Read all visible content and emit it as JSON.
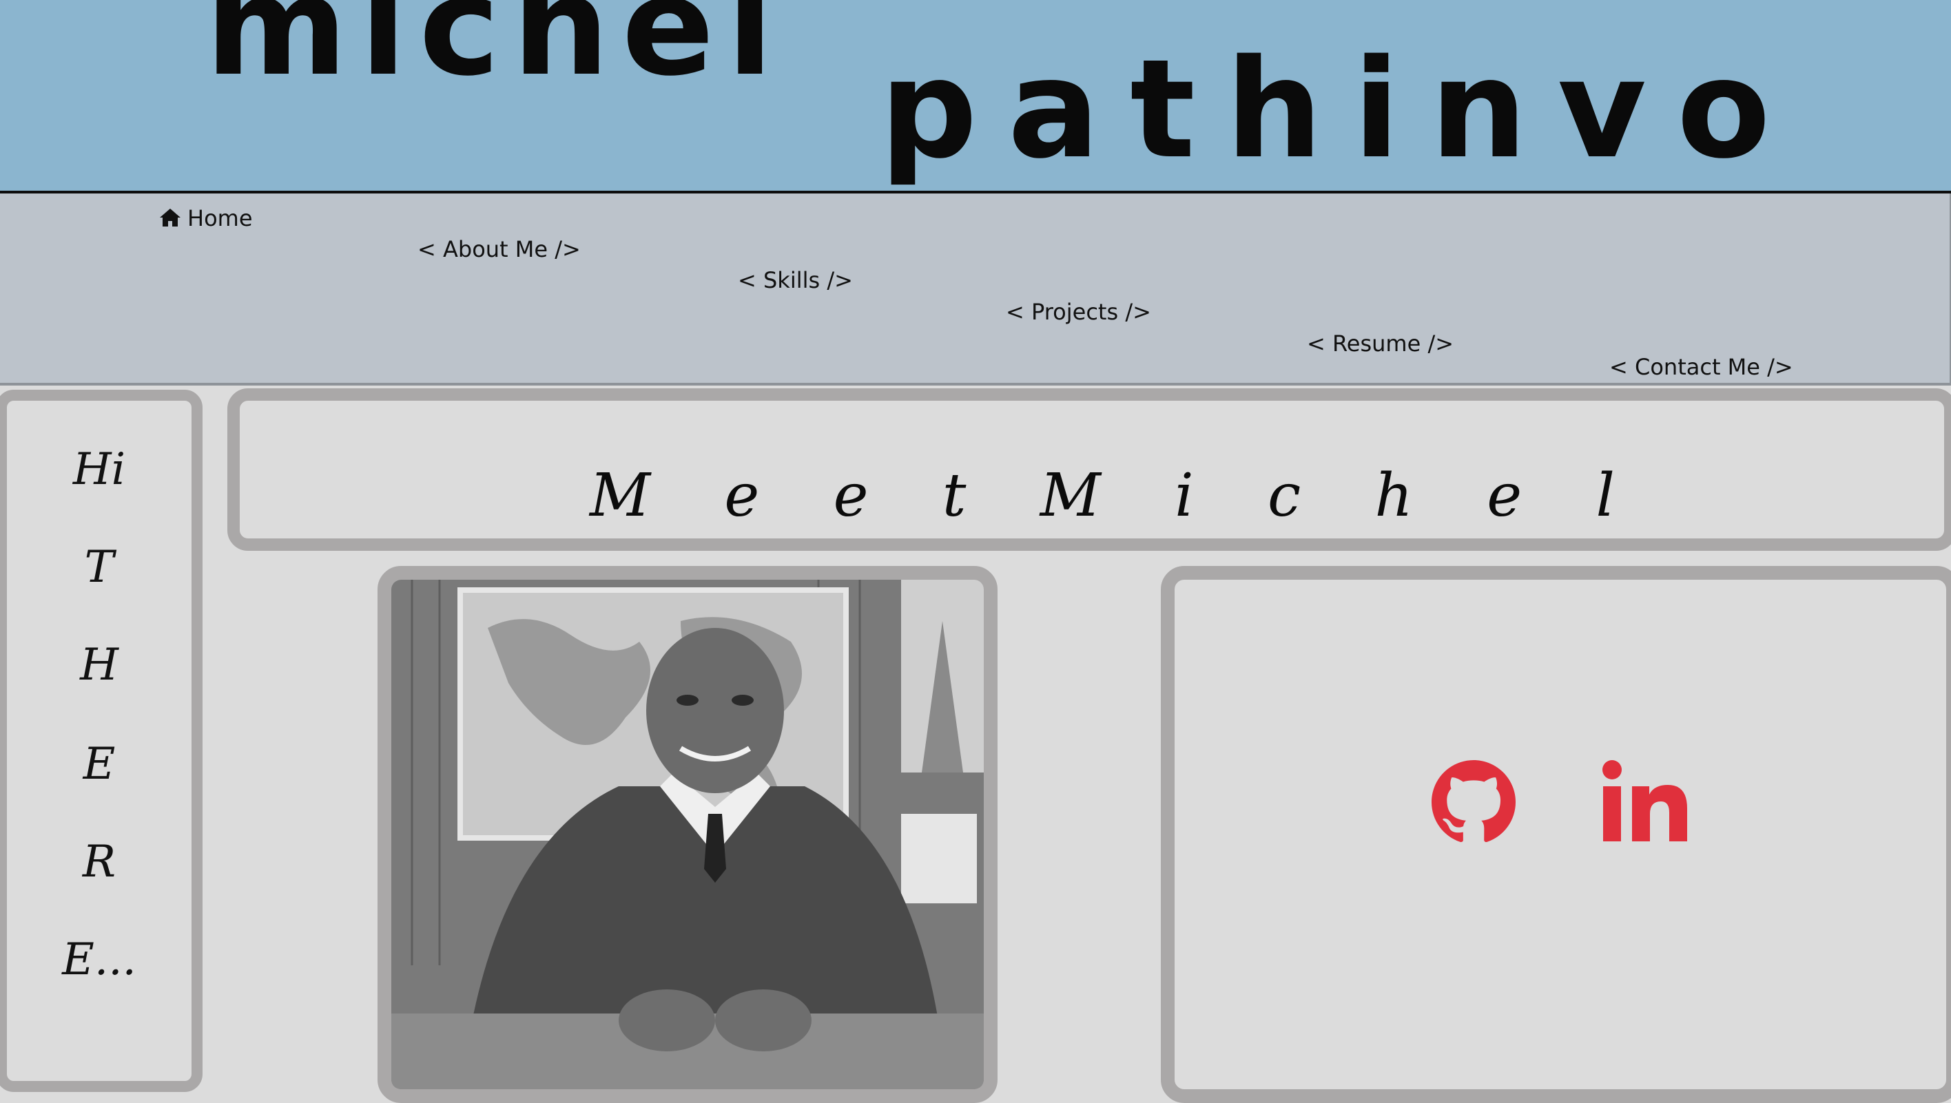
{
  "header": {
    "first_name": "michel",
    "last_name": "pathinvo"
  },
  "nav": {
    "items": [
      {
        "label": "Home",
        "icon": "home-icon"
      },
      {
        "label": "< About Me />"
      },
      {
        "label": "< Skills />"
      },
      {
        "label": "< Projects />"
      },
      {
        "label": "< Resume />"
      },
      {
        "label": "< Contact Me />"
      }
    ]
  },
  "sidebar": {
    "letters": [
      "Hi",
      "T",
      "H",
      "E",
      "R",
      "E..."
    ]
  },
  "main": {
    "title": "M e e t   M i c h e l"
  },
  "social": {
    "icons": [
      "github-icon",
      "linkedin-icon"
    ],
    "color": "#e0303c"
  },
  "colors": {
    "header_bg": "#8bb5cf",
    "nav_bg": "#bcc3cb",
    "page_bg": "#dcdcdc",
    "frame": "#aaa8a8"
  }
}
